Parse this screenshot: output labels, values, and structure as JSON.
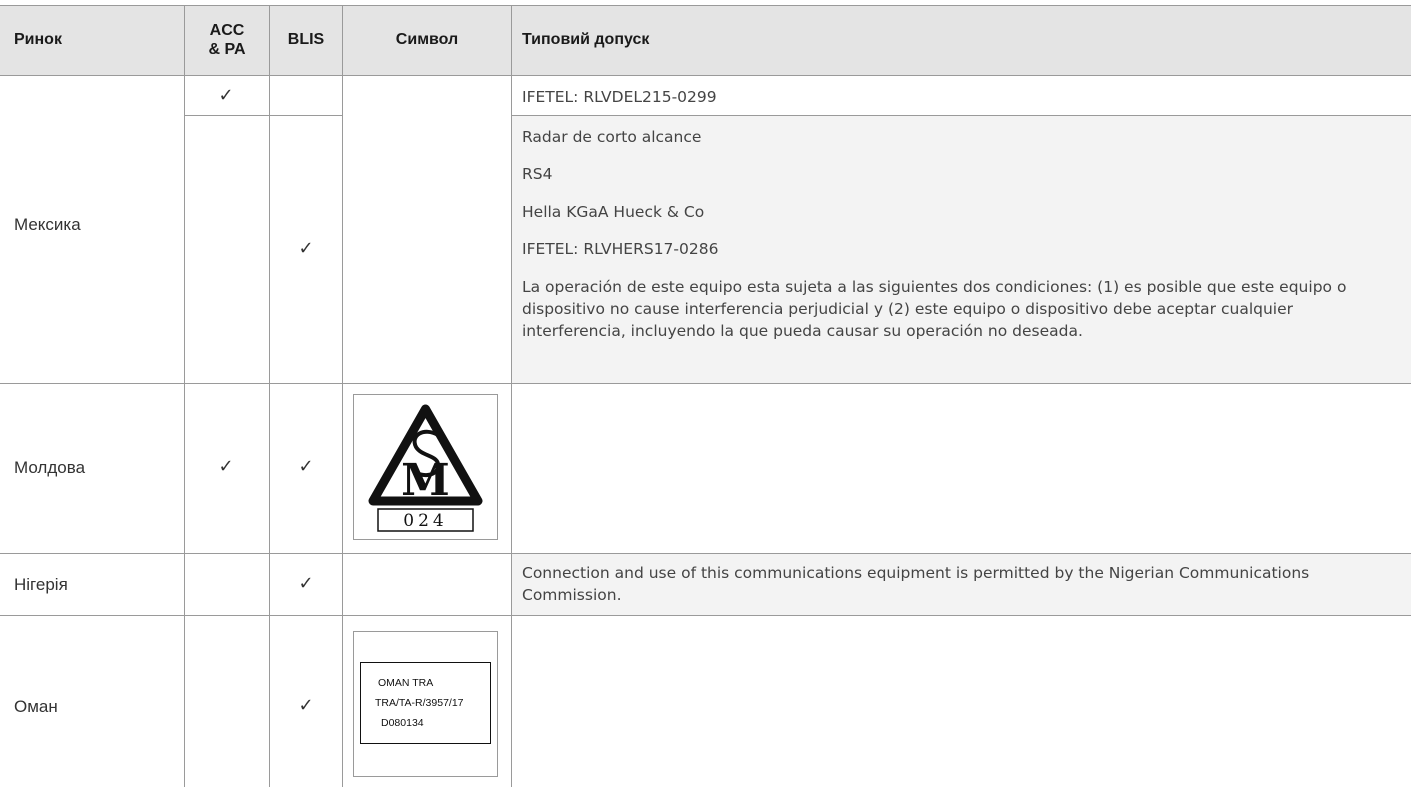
{
  "header": {
    "market": "Ринок",
    "acc_line1": "ACC",
    "acc_line2": "& PA",
    "blis": "BLIS",
    "symbol": "Символ",
    "approval": "Типовий допуск"
  },
  "rows": {
    "mexico": {
      "market": "Мексика",
      "acc_check": "✓",
      "blis_check": "✓",
      "line_acc": "IFETEL: RLVDEL215-0299",
      "line1": "Radar de corto alcance",
      "line2": "RS4",
      "line3": "Hella KGaA Hueck & Co",
      "line4": "IFETEL: RLVHERS17-0286",
      "line5": "La operación de este equipo esta sujeta a las siguientes dos condiciones: (1) es posible que este equipo o dispositivo no cause interferencia perjudicial y (2) este equipo o dispositivo debe aceptar cualquier interferencia, incluyendo la que pueda causar su operación no deseada."
    },
    "moldova": {
      "market": "Молдова",
      "acc_check": "✓",
      "blis_check": "✓",
      "mark_number": "024"
    },
    "nigeria": {
      "market": "Нігерія",
      "blis_check": "✓",
      "approval": "Connection and use of this communications equipment is permitted by the Nigerian Communications Commission."
    },
    "oman": {
      "market": "Оман",
      "blis_check": "✓",
      "label_line1": "OMAN TRA",
      "label_line2": "TRA/TA-R/3957/17",
      "label_line3": "D080134"
    }
  }
}
